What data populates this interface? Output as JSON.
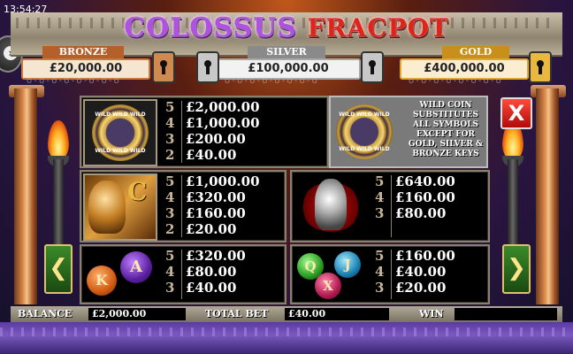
{
  "status_bar": {
    "time": "13:54:27"
  },
  "title": {
    "part1": "COLOSSUS",
    "part2": "FRACPOT"
  },
  "jackpots": [
    {
      "label": "BRONZE",
      "amount": "£20,000.00",
      "color": "#d08a50"
    },
    {
      "label": "SILVER",
      "amount": "£100,000.00",
      "color": "#c8c8c8"
    },
    {
      "label": "GOLD",
      "amount": "£400,000.00",
      "color": "#e8b840"
    }
  ],
  "paytable": {
    "wild": {
      "counts": [
        "5",
        "4",
        "3",
        "2"
      ],
      "prizes": [
        "£2,000.00",
        "£1,000.00",
        "£200.00",
        "£40.00"
      ],
      "coin_text": "WILD WILD WILD",
      "description": [
        "WILD COIN",
        "SUBSTITUTES",
        "ALL SYMBOLS",
        "EXCEPT FOR",
        "GOLD, SILVER &",
        "BRONZE KEYS"
      ]
    },
    "gladiator": {
      "letter": "C",
      "counts": [
        "5",
        "4",
        "3",
        "2"
      ],
      "prizes": [
        "£1,000.00",
        "£320.00",
        "£160.00",
        "£20.00"
      ]
    },
    "helmet": {
      "counts": [
        "5",
        "4",
        "3"
      ],
      "prizes": [
        "£640.00",
        "£160.00",
        "£80.00"
      ]
    },
    "gems_ka": {
      "letters": [
        "K",
        "A"
      ],
      "counts": [
        "5",
        "4",
        "3"
      ],
      "prizes": [
        "£320.00",
        "£80.00",
        "£40.00"
      ]
    },
    "gems_qjx": {
      "letters": [
        "Q",
        "J",
        "X"
      ],
      "counts": [
        "5",
        "4",
        "3"
      ],
      "prizes": [
        "£160.00",
        "£40.00",
        "£20.00"
      ]
    }
  },
  "buttons": {
    "close": "X",
    "prev": "❮",
    "next": "❯",
    "lobby": "›"
  },
  "footer": {
    "balance_label": "BALANCE",
    "balance_value": "£2,000.00",
    "bet_label": "TOTAL BET",
    "bet_value": "£40.00",
    "win_label": "WIN",
    "win_value": ""
  }
}
